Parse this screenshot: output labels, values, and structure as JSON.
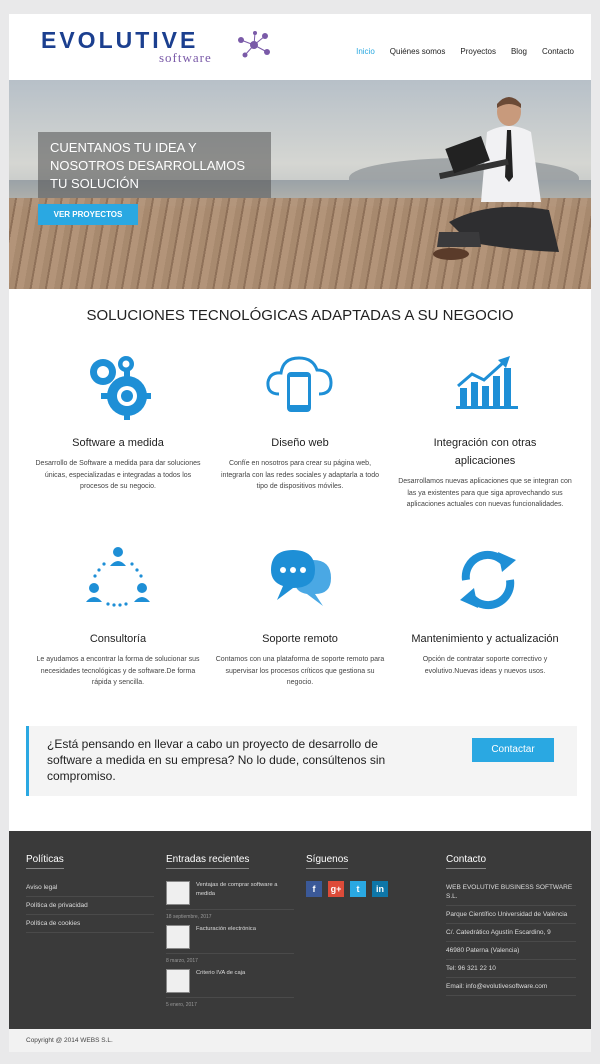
{
  "header": {
    "logo_word": "EVOLUTIVE",
    "logo_sub": "software",
    "nav": [
      "Inicio",
      "Quiénes somos",
      "Proyectos",
      "Blog",
      "Contacto"
    ]
  },
  "hero": {
    "title": "CUENTANOS TU IDEA Y NOSOTROS DESARROLLAMOS TU SOLUCIÓN",
    "button": "VER PROYECTOS"
  },
  "solutions": {
    "title": "SOLUCIONES TECNOLÓGICAS ADAPTADAS A SU NEGOCIO",
    "items": [
      {
        "icon": "gears-icon",
        "name": "Software a medida",
        "desc": "Desarrollo de Software a medida para dar soluciones únicas, especializadas e integradas a todos los procesos de su negocio."
      },
      {
        "icon": "cloud-mobile-icon",
        "name": "Diseño web",
        "desc": "Confíe en nosotros para crear su página web, integrarla con las redes sociales y adaptarla a todo tipo de dispositivos móviles."
      },
      {
        "icon": "growth-chart-icon",
        "name": "Integración con otras aplicaciones",
        "desc": "Desarrollamos nuevas aplicaciones que se integran con las ya existentes para que siga aprovechando sus aplicaciones actuales con nuevas funcionalidades."
      },
      {
        "icon": "network-people-icon",
        "name": "Consultoría",
        "desc": "Le ayudamos a encontrar la forma de solucionar sus necesidades tecnológicas y de software.De forma rápida y sencilla."
      },
      {
        "icon": "chat-bubbles-icon",
        "name": "Soporte remoto",
        "desc": "Contamos con una plataforma de soporte remoto para supervisar los procesos críticos que gestiona su negocio."
      },
      {
        "icon": "refresh-icon",
        "name": "Mantenimiento y actualización",
        "desc": "Opción de contratar soporte correctivo y evolutivo.Nuevas ideas y nuevos usos."
      }
    ]
  },
  "cta": {
    "text": "¿Está pensando en llevar a cabo un proyecto de desarrollo de software a medida en su empresa? No lo dude, consúltenos sin compromiso.",
    "button": "Contactar"
  },
  "footer": {
    "policies": {
      "title": "Políticas",
      "items": [
        "Aviso legal",
        "Política de privacidad",
        "Política de cookies"
      ]
    },
    "recent": {
      "title": "Entradas recientes",
      "posts": [
        {
          "title": "Ventajas de comprar software a medida",
          "date": "18 septiembre, 2017"
        },
        {
          "title": "Facturación electrónica",
          "date": "8 marzo, 2017"
        },
        {
          "title": "Criterio IVA de caja",
          "date": "5 enero, 2017"
        }
      ]
    },
    "follow": {
      "title": "Síguenos",
      "networks": [
        {
          "name": "facebook-icon",
          "glyph": "f",
          "color": "#3b5998"
        },
        {
          "name": "google-plus-icon",
          "glyph": "g+",
          "color": "#dd4b39"
        },
        {
          "name": "twitter-icon",
          "glyph": "t",
          "color": "#2aa8e2"
        },
        {
          "name": "linkedin-icon",
          "glyph": "in",
          "color": "#0e76a8"
        }
      ]
    },
    "contact": {
      "title": "Contacto",
      "items": [
        "WEB EVOLUTIVE BUSINESS SOFTWARE S.L.",
        "Parque Científico Universidad de València",
        "C/. Catedrático Agustín Escardino, 9",
        "46980 Paterna (Valencia)",
        "Tel: 96 321 22 10",
        "Email: info@evolutivesoftware.com"
      ]
    }
  },
  "copyright": "Copyright @ 2014 WEBS S.L."
}
